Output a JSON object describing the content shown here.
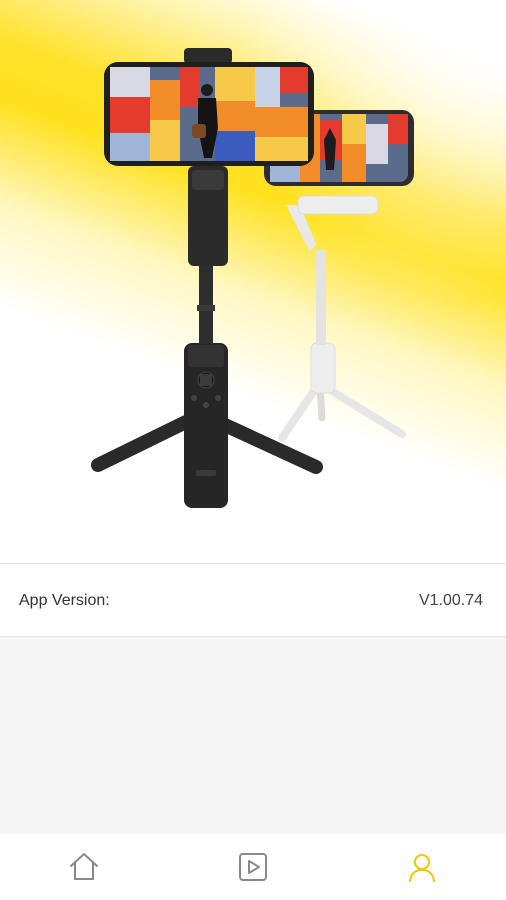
{
  "hero": {
    "image_name": "gimbal-product-image"
  },
  "info": {
    "label": "App Version:",
    "value": "V1.00.74"
  },
  "tabs": [
    {
      "name": "tab-home",
      "icon": "home-icon",
      "active": false
    },
    {
      "name": "tab-media",
      "icon": "play-icon",
      "active": false
    },
    {
      "name": "tab-profile",
      "icon": "user-icon",
      "active": true
    }
  ],
  "colors": {
    "accent": "#f5c400",
    "icon_inactive": "#8a8a8a",
    "hero_yellow": "#ffe11f"
  }
}
